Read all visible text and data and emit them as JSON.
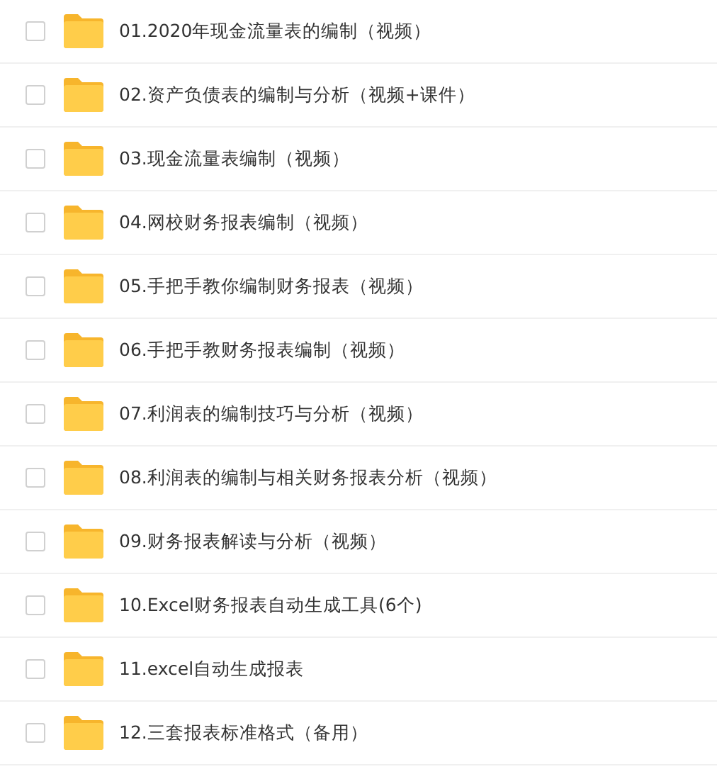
{
  "files": [
    {
      "name": "01.2020年现金流量表的编制（视频）",
      "checked": false
    },
    {
      "name": "02.资产负债表的编制与分析（视频+课件）",
      "checked": false
    },
    {
      "name": "03.现金流量表编制（视频）",
      "checked": false
    },
    {
      "name": "04.网校财务报表编制（视频）",
      "checked": false
    },
    {
      "name": "05.手把手教你编制财务报表（视频）",
      "checked": false
    },
    {
      "name": "06.手把手教财务报表编制（视频）",
      "checked": false
    },
    {
      "name": "07.利润表的编制技巧与分析（视频）",
      "checked": false
    },
    {
      "name": "08.利润表的编制与相关财务报表分析（视频）",
      "checked": false
    },
    {
      "name": "09.财务报表解读与分析（视频）",
      "checked": false
    },
    {
      "name": "10.Excel财务报表自动生成工具(6个)",
      "checked": false
    },
    {
      "name": "11.excel自动生成报表",
      "checked": false
    },
    {
      "name": "12.三套报表标准格式（备用）",
      "checked": false
    }
  ]
}
